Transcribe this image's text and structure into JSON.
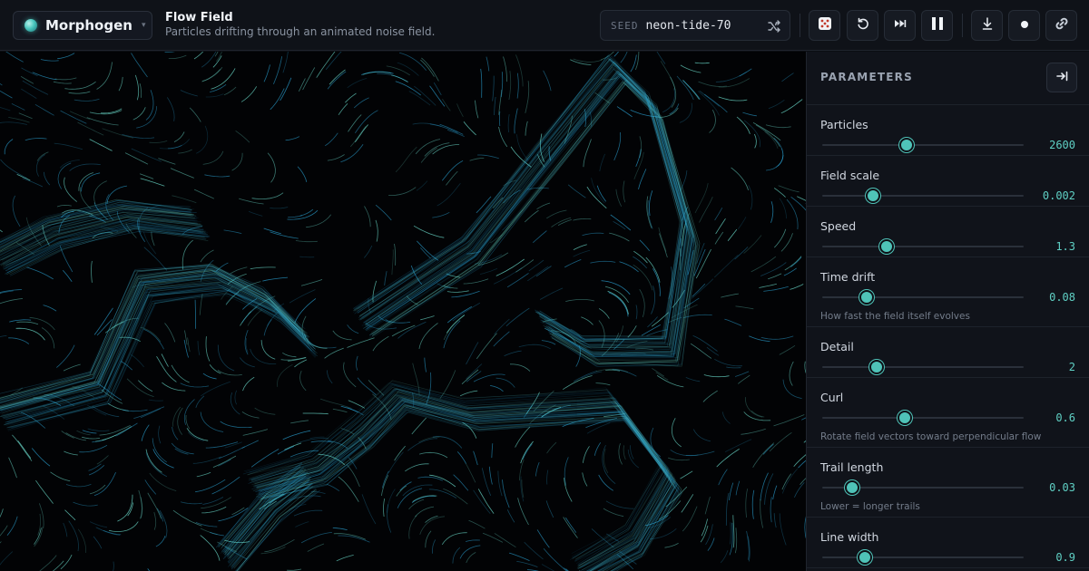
{
  "app": {
    "name": "Morphogen",
    "logo_icon": "orb-logo-icon",
    "caret": "▾"
  },
  "page": {
    "title": "Flow Field",
    "subtitle": "Particles drifting through an animated noise field."
  },
  "seed": {
    "label": "SEED",
    "value": "neon-tide-70",
    "shuffle_icon": "shuffle-icon"
  },
  "toolbar": {
    "randomize_icon": "dice-icon",
    "reset_icon": "reset-icon",
    "step_icon": "step-forward-icon",
    "pause_icon": "pause-icon",
    "download_icon": "download-icon",
    "record_icon": "record-icon",
    "link_icon": "link-icon"
  },
  "panel": {
    "title": "PARAMETERS",
    "collapse_icon": "collapse-panel-icon",
    "params": [
      {
        "label": "Particles",
        "value": "2600",
        "fraction": 0.42,
        "hint": ""
      },
      {
        "label": "Field scale",
        "value": "0.002",
        "fraction": 0.25,
        "hint": ""
      },
      {
        "label": "Speed",
        "value": "1.3",
        "fraction": 0.32,
        "hint": ""
      },
      {
        "label": "Time drift",
        "value": "0.08",
        "fraction": 0.22,
        "hint": "How fast the field itself evolves"
      },
      {
        "label": "Detail",
        "value": "2",
        "fraction": 0.27,
        "hint": ""
      },
      {
        "label": "Curl",
        "value": "0.6",
        "fraction": 0.41,
        "hint": "Rotate field vectors toward perpendicular flow"
      },
      {
        "label": "Trail length",
        "value": "0.03",
        "fraction": 0.15,
        "hint": "Lower = longer trails"
      },
      {
        "label": "Line width",
        "value": "0.9",
        "fraction": 0.21,
        "hint": ""
      }
    ]
  },
  "colors": {
    "accent": "#4fc3b8",
    "canvas_bg": "#020305",
    "stroke_a": "#2a9fd0",
    "stroke_b": "#6fe3d2"
  }
}
